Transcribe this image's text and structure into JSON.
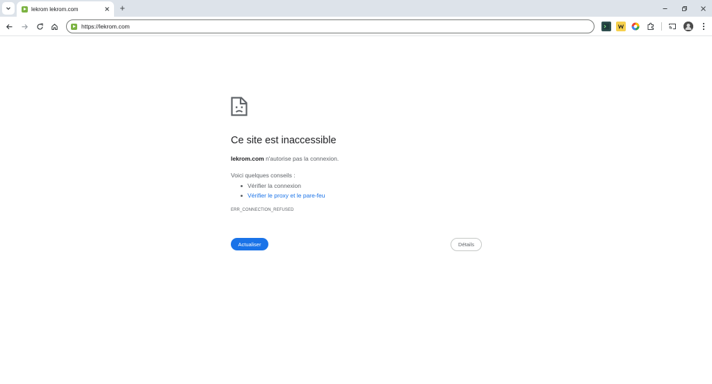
{
  "browser": {
    "tab": {
      "title": "lekrom lekrom.com"
    },
    "new_tab_label": "+",
    "address_bar": {
      "url": "https://lekrom.com"
    },
    "icons": {
      "tab_search": "chevron-down-icon",
      "back": "back-arrow-icon",
      "forward": "forward-arrow-icon",
      "reload": "reload-icon",
      "home": "home-icon",
      "extensions": "puzzle-icon",
      "cast": "cast-icon",
      "menu": "kebab-menu-icon"
    }
  },
  "error_page": {
    "icon": "sad-document-icon",
    "title": "Ce site est inaccessible",
    "host": "lekrom.com",
    "message_suffix": " n'autorise pas la connexion.",
    "tips_label": "Voici quelques conseils :",
    "tips": [
      {
        "text": "Vérifier la connexion",
        "is_link": false
      },
      {
        "text": "Vérifier le proxy et le pare-feu",
        "is_link": true
      }
    ],
    "error_code": "ERR_CONNECTION_REFUSED",
    "reload_button": "Actualiser",
    "details_button": "Détails"
  },
  "colors": {
    "accent": "#1a73e8",
    "tabstrip_bg": "#dde3ea",
    "favicon": "#7cb342"
  }
}
